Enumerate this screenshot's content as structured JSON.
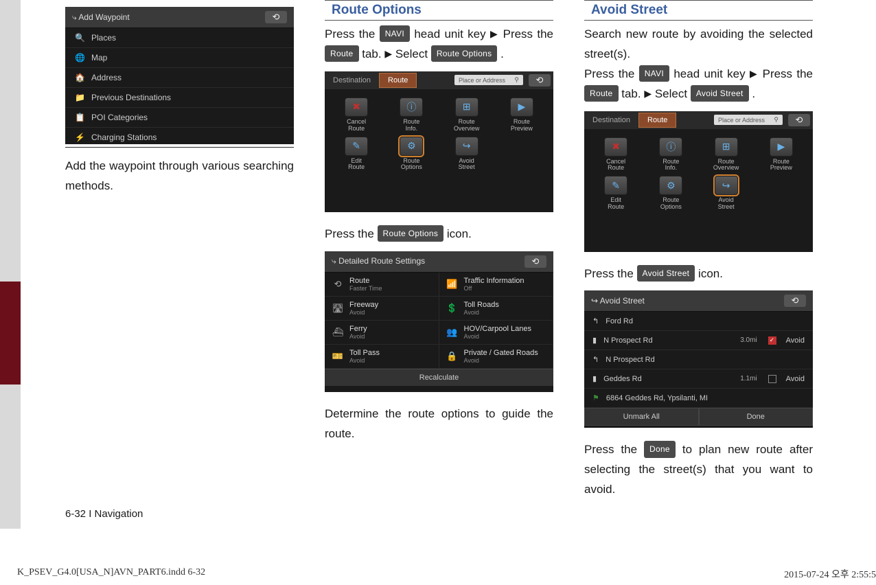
{
  "col1": {
    "addwp_title": "Add Waypoint",
    "menu": [
      "Places",
      "Map",
      "Address",
      "Previous Destinations",
      "POI Categories",
      "Charging Stations"
    ],
    "caption": "Add the waypoint through various search­ing methods."
  },
  "col2": {
    "heading": "Route Options",
    "p1_a": "Press the ",
    "navi": "NAVI",
    "p1_b": " head unit key ",
    "p1_c": " Press the ",
    "route": "Route",
    "p1_d": " tab. ",
    "p1_e": " Select ",
    "routeopts": "Route Options",
    "period": " .",
    "tabs": {
      "dest": "Destination",
      "route": "Route",
      "search": "Place or Address"
    },
    "grid": [
      {
        "label": "Cancel\nRoute"
      },
      {
        "label": "Route\nInfo."
      },
      {
        "label": "Route\nOverview"
      },
      {
        "label": "Route\nPreview"
      },
      {
        "label": "Edit\nRoute"
      },
      {
        "label": "Route\nOptions"
      },
      {
        "label": "Avoid\nStreet"
      }
    ],
    "p2_a": "Press the ",
    "p2_b": " icon.",
    "detail_title": "Detailed Route Settings",
    "detail": [
      {
        "m": "Route",
        "s": "Faster Time"
      },
      {
        "m": "Traffic Information",
        "s": "Off"
      },
      {
        "m": "Freeway",
        "s": "Avoid"
      },
      {
        "m": "Toll Roads",
        "s": "Avoid"
      },
      {
        "m": "Ferry",
        "s": "Avoid"
      },
      {
        "m": "HOV/Carpool Lanes",
        "s": "Avoid"
      },
      {
        "m": "Toll Pass",
        "s": "Avoid"
      },
      {
        "m": "Private / Gated Roads",
        "s": "Avoid"
      }
    ],
    "recalc": "Recalculate",
    "p3": "Determine the route options to guide the route."
  },
  "col3": {
    "heading": "Avoid Street",
    "intro": "Search new route by avoiding the selected street(s).",
    "p1_a": "Press the ",
    "navi": "NAVI",
    "p1_b": " head unit key ",
    "p1_c": " Press the ",
    "route": "Route",
    "p1_d": " tab. ",
    "p1_e": " Select ",
    "avoidst": "Avoid Street",
    "period": " .",
    "p2_a": "Press the ",
    "p2_b": " icon.",
    "avoid_title": "Avoid Street",
    "streets": [
      {
        "n": "Ford Rd",
        "d": "",
        "c": false,
        "ico": "↰"
      },
      {
        "n": "N Prospect Rd",
        "d": "3.0mi",
        "c": true,
        "avoid": "Avoid",
        "ico": "▮"
      },
      {
        "n": "N Prospect Rd",
        "d": "",
        "c": false,
        "ico": "↰"
      },
      {
        "n": "Geddes Rd",
        "d": "1.1mi",
        "c": false,
        "avoid": "Avoid",
        "ico": "▮"
      },
      {
        "n": "6864 Geddes Rd, Ypsilanti, MI",
        "d": "",
        "c": false,
        "ico": "⚑"
      }
    ],
    "unmark": "Unmark All",
    "done": "Done",
    "p3_a": "Press the ",
    "donebtn": "Done",
    "p3_b": " to plan new route after selecting the street(s) that you want to avoid."
  },
  "footer": "6-32 I Navigation",
  "indd_l": "K_PSEV_G4.0[USA_N]AVN_PART6.indd   6-32",
  "indd_r": "2015-07-24   오후 2:55:5",
  "arrow": "▶"
}
